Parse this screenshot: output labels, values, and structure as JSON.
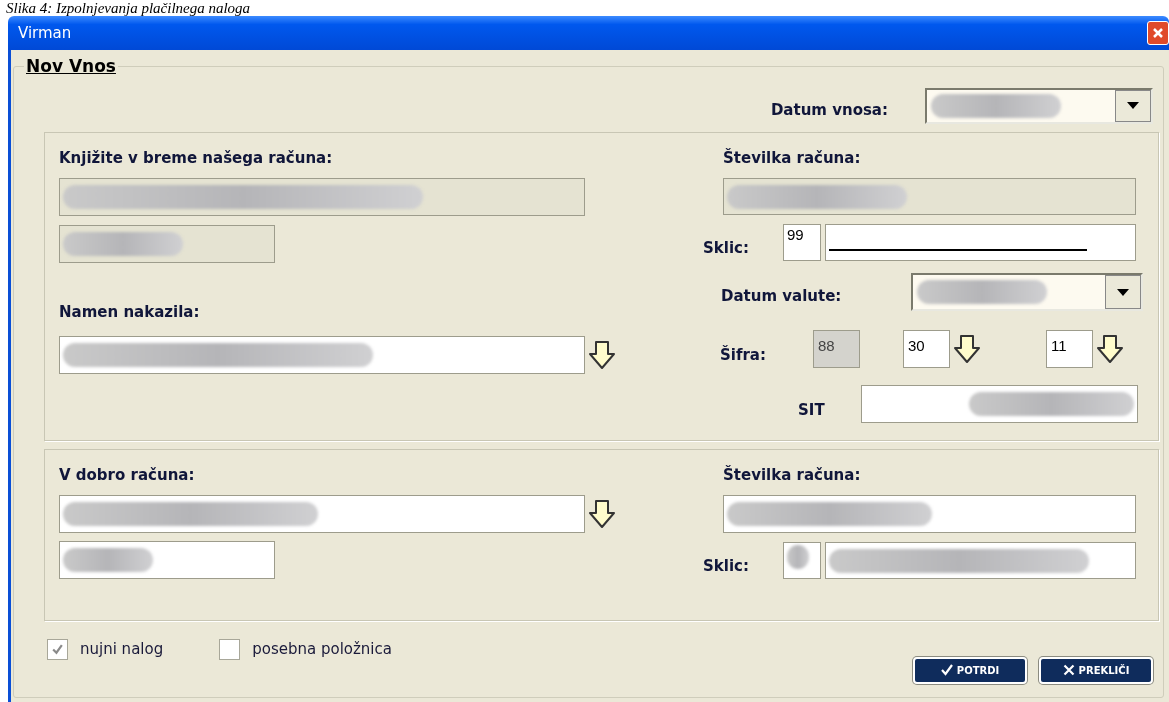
{
  "caption": "Slika 4: Izpolnjevanja plačilnega naloga",
  "window": {
    "title": "Virman"
  },
  "group": {
    "title": "Nov Vnos"
  },
  "entry_date": {
    "label": "Datum vnosa:"
  },
  "debit": {
    "label": "Knjižite v breme našega računa:",
    "account_label": "Številka računa:",
    "reference_label": "Sklic:",
    "reference_model": "99"
  },
  "purpose": {
    "label": "Namen nakazila:"
  },
  "value_date": {
    "label": "Datum valute:"
  },
  "code": {
    "label": "Šifra:",
    "fields": [
      {
        "value": "88",
        "disabled": true
      },
      {
        "value": "30",
        "disabled": false
      },
      {
        "value": "11",
        "disabled": false
      }
    ]
  },
  "amount": {
    "label": "SIT"
  },
  "credit": {
    "label": "V dobro računa:",
    "account_label": "Številka računa:",
    "reference_label": "Sklic:"
  },
  "options": [
    {
      "label": "nujni nalog",
      "checked": true
    },
    {
      "label": "posebna položnica",
      "checked": false
    }
  ],
  "buttons": [
    {
      "label": "POTRDI",
      "kind": "confirm"
    },
    {
      "label": "PREKLIČI",
      "kind": "cancel"
    }
  ]
}
